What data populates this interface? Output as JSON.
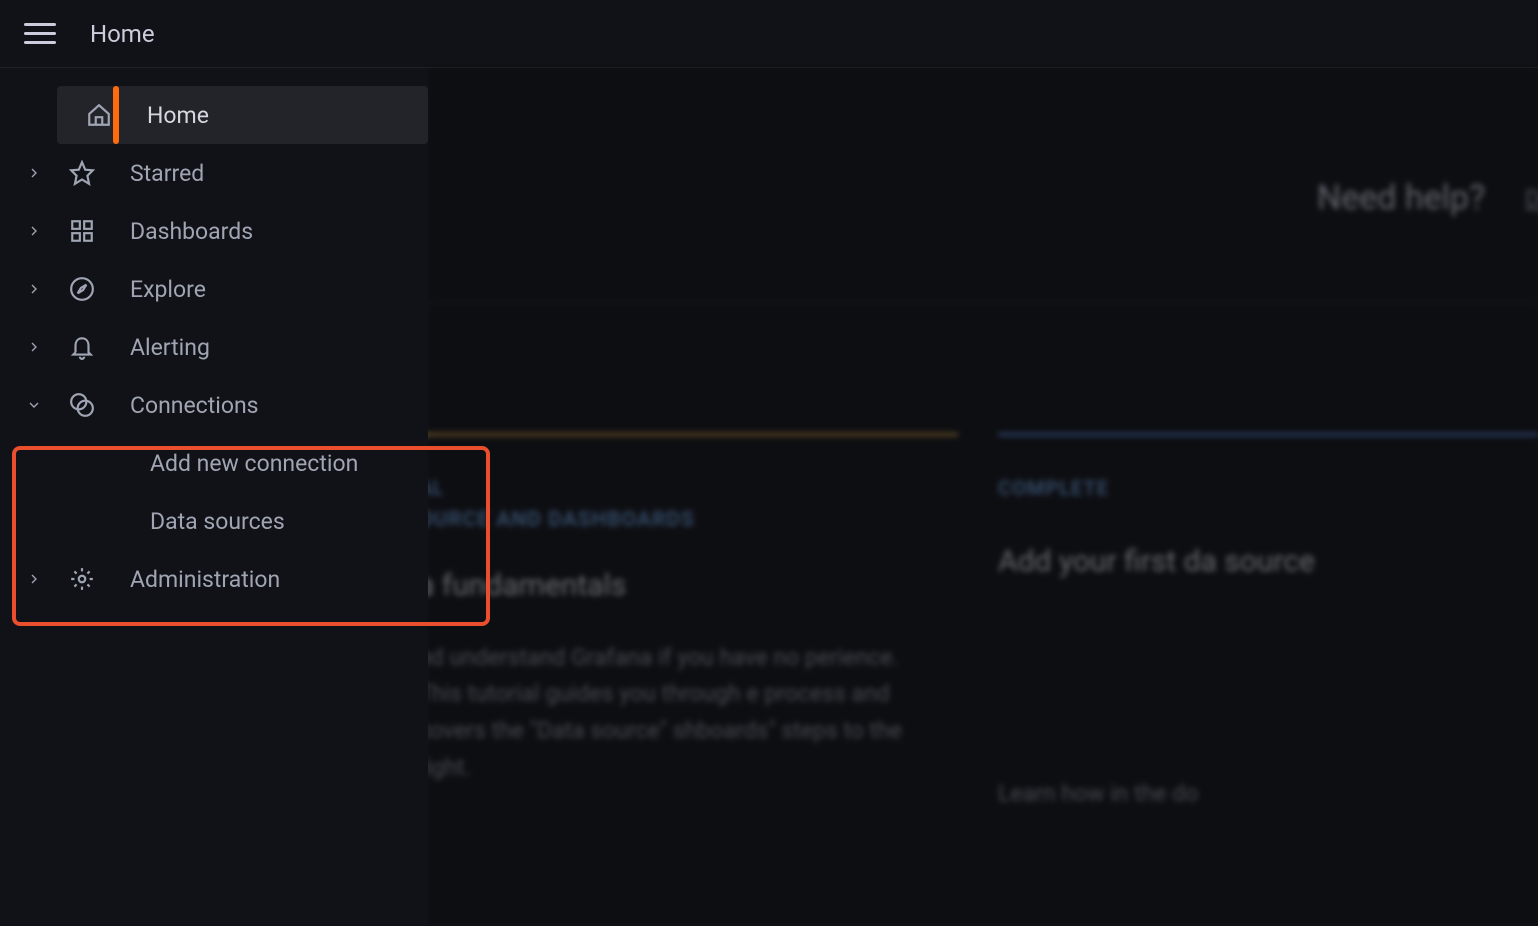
{
  "breadcrumb": "Home",
  "sidebar": {
    "items": [
      {
        "label": "Home",
        "icon": "home",
        "active": true,
        "expandable": false
      },
      {
        "label": "Starred",
        "icon": "star",
        "expandable": true
      },
      {
        "label": "Dashboards",
        "icon": "grid",
        "expandable": true
      },
      {
        "label": "Explore",
        "icon": "compass",
        "expandable": true
      },
      {
        "label": "Alerting",
        "icon": "bell",
        "expandable": true
      },
      {
        "label": "Connections",
        "icon": "plug",
        "expandable": true,
        "expanded": true,
        "children": [
          {
            "label": "Add new connection"
          },
          {
            "label": "Data sources"
          }
        ]
      },
      {
        "label": "Administration",
        "icon": "gear",
        "expandable": true
      }
    ]
  },
  "content": {
    "help": {
      "title": "Need help?",
      "docs_link": "Docu"
    },
    "cards": {
      "tutorial": {
        "kicker": "AL",
        "subkicker": "OURCE AND DASHBOARDS",
        "title": "a fundamentals",
        "body": "nd understand Grafana if you have no perience. This tutorial guides you through e process and covers the \"Data source\" shboards\" steps to the right."
      },
      "complete": {
        "kicker": "COMPLETE",
        "title": "Add your first da source",
        "body": "Learn how in the do"
      }
    }
  }
}
